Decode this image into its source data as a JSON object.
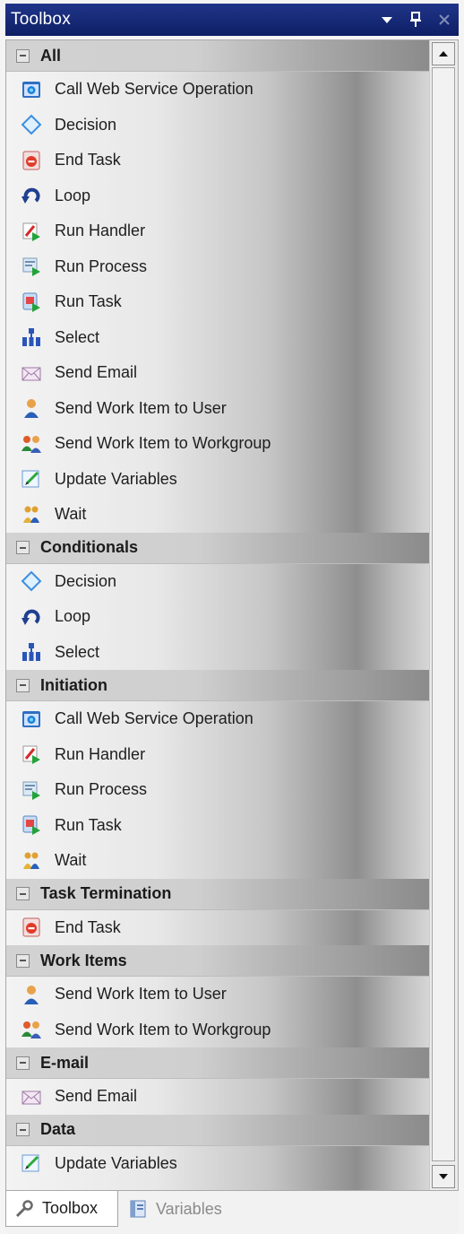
{
  "window": {
    "title": "Toolbox"
  },
  "sections": [
    {
      "label": "All",
      "items": [
        {
          "label": "Call Web Service Operation",
          "icon": "web-service-icon"
        },
        {
          "label": "Decision",
          "icon": "decision-icon"
        },
        {
          "label": "End Task",
          "icon": "end-task-icon"
        },
        {
          "label": "Loop",
          "icon": "loop-icon"
        },
        {
          "label": "Run Handler",
          "icon": "run-handler-icon"
        },
        {
          "label": "Run Process",
          "icon": "run-process-icon"
        },
        {
          "label": "Run Task",
          "icon": "run-task-icon"
        },
        {
          "label": "Select",
          "icon": "select-icon"
        },
        {
          "label": "Send Email",
          "icon": "email-icon"
        },
        {
          "label": "Send Work Item to User",
          "icon": "user-icon"
        },
        {
          "label": "Send Work Item to Workgroup",
          "icon": "workgroup-icon"
        },
        {
          "label": "Update Variables",
          "icon": "update-variables-icon"
        },
        {
          "label": "Wait",
          "icon": "wait-icon"
        }
      ]
    },
    {
      "label": "Conditionals",
      "items": [
        {
          "label": "Decision",
          "icon": "decision-icon"
        },
        {
          "label": "Loop",
          "icon": "loop-icon"
        },
        {
          "label": "Select",
          "icon": "select-icon"
        }
      ]
    },
    {
      "label": "Initiation",
      "items": [
        {
          "label": "Call Web Service Operation",
          "icon": "web-service-icon"
        },
        {
          "label": "Run Handler",
          "icon": "run-handler-icon"
        },
        {
          "label": "Run Process",
          "icon": "run-process-icon"
        },
        {
          "label": "Run Task",
          "icon": "run-task-icon"
        },
        {
          "label": "Wait",
          "icon": "wait-icon"
        }
      ]
    },
    {
      "label": "Task Termination",
      "items": [
        {
          "label": "End Task",
          "icon": "end-task-icon"
        }
      ]
    },
    {
      "label": "Work Items",
      "items": [
        {
          "label": "Send Work Item to User",
          "icon": "user-icon"
        },
        {
          "label": "Send Work Item to Workgroup",
          "icon": "workgroup-icon"
        }
      ]
    },
    {
      "label": "E-mail",
      "items": [
        {
          "label": "Send Email",
          "icon": "email-icon"
        }
      ]
    },
    {
      "label": "Data",
      "items": [
        {
          "label": "Update Variables",
          "icon": "update-variables-icon"
        }
      ]
    }
  ],
  "tabs": [
    {
      "label": "Toolbox",
      "icon": "wrench-icon",
      "active": true
    },
    {
      "label": "Variables",
      "icon": "variables-icon",
      "active": false
    }
  ]
}
